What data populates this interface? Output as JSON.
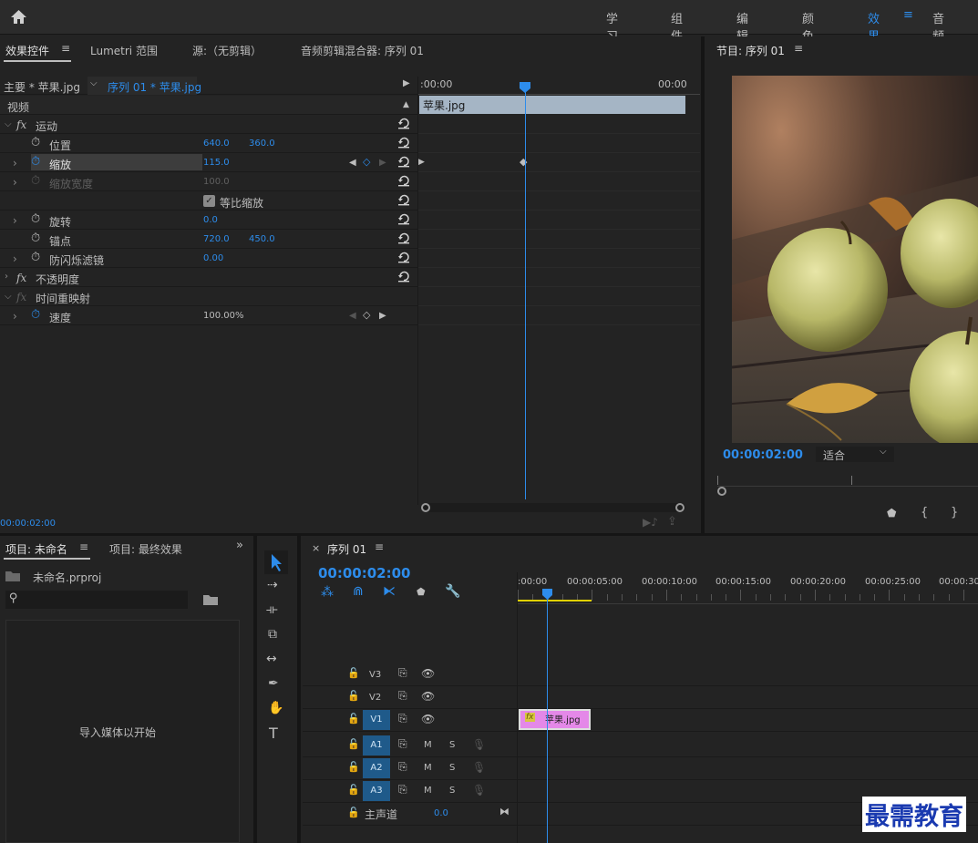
{
  "topbar": {
    "workspaces": [
      "学习",
      "组件",
      "编辑",
      "颜色",
      "效果",
      "音频"
    ],
    "active": "效果"
  },
  "effects_panel": {
    "tabs": [
      "效果控件",
      "Lumetri 范围",
      "源:（无剪辑）",
      "音频剪辑混合器: 序列 01"
    ],
    "master": "主要 * 苹果.jpg",
    "clip": "序列 01 * 苹果.jpg",
    "section": "视频",
    "rows": [
      {
        "label": "运动"
      },
      {
        "label": "位置",
        "v1": "640.0",
        "v2": "360.0"
      },
      {
        "label": "缩放",
        "v1": "115.0"
      },
      {
        "label": "缩放宽度",
        "v1": "100.0"
      },
      {
        "label": "等比缩放"
      },
      {
        "label": "旋转",
        "v1": "0.0"
      },
      {
        "label": "锚点",
        "v1": "720.0",
        "v2": "450.0"
      },
      {
        "label": "防闪烁滤镜",
        "v1": "0.00"
      },
      {
        "label": "不透明度"
      },
      {
        "label": "时间重映射"
      },
      {
        "label": "速度",
        "v1": "100.00%"
      }
    ],
    "timecode": "00:00:02:00",
    "mini_timeline": {
      "start": ":00:00",
      "end": "00:00",
      "clip": "苹果.jpg"
    }
  },
  "program": {
    "title": "节目: 序列 01",
    "timecode": "00:00:02:00",
    "fit": "适合"
  },
  "project": {
    "tabs": [
      "项目: 未命名",
      "项目: 最终效果"
    ],
    "file": "未命名.prproj",
    "empty_msg": "导入媒体以开始"
  },
  "sequence": {
    "tab": "序列 01",
    "timecode": "00:00:02:00",
    "ruler": [
      ":00:00",
      "00:00:05:00",
      "00:00:10:00",
      "00:00:15:00",
      "00:00:20:00",
      "00:00:25:00",
      "00:00:30"
    ],
    "tracks": [
      "V3",
      "V2",
      "V1",
      "A1",
      "A2",
      "A3"
    ],
    "master": "主声道",
    "master_val": "0.0",
    "clip": "苹果.jpg",
    "m": "M",
    "s": "S"
  },
  "watermark": "最需教育"
}
